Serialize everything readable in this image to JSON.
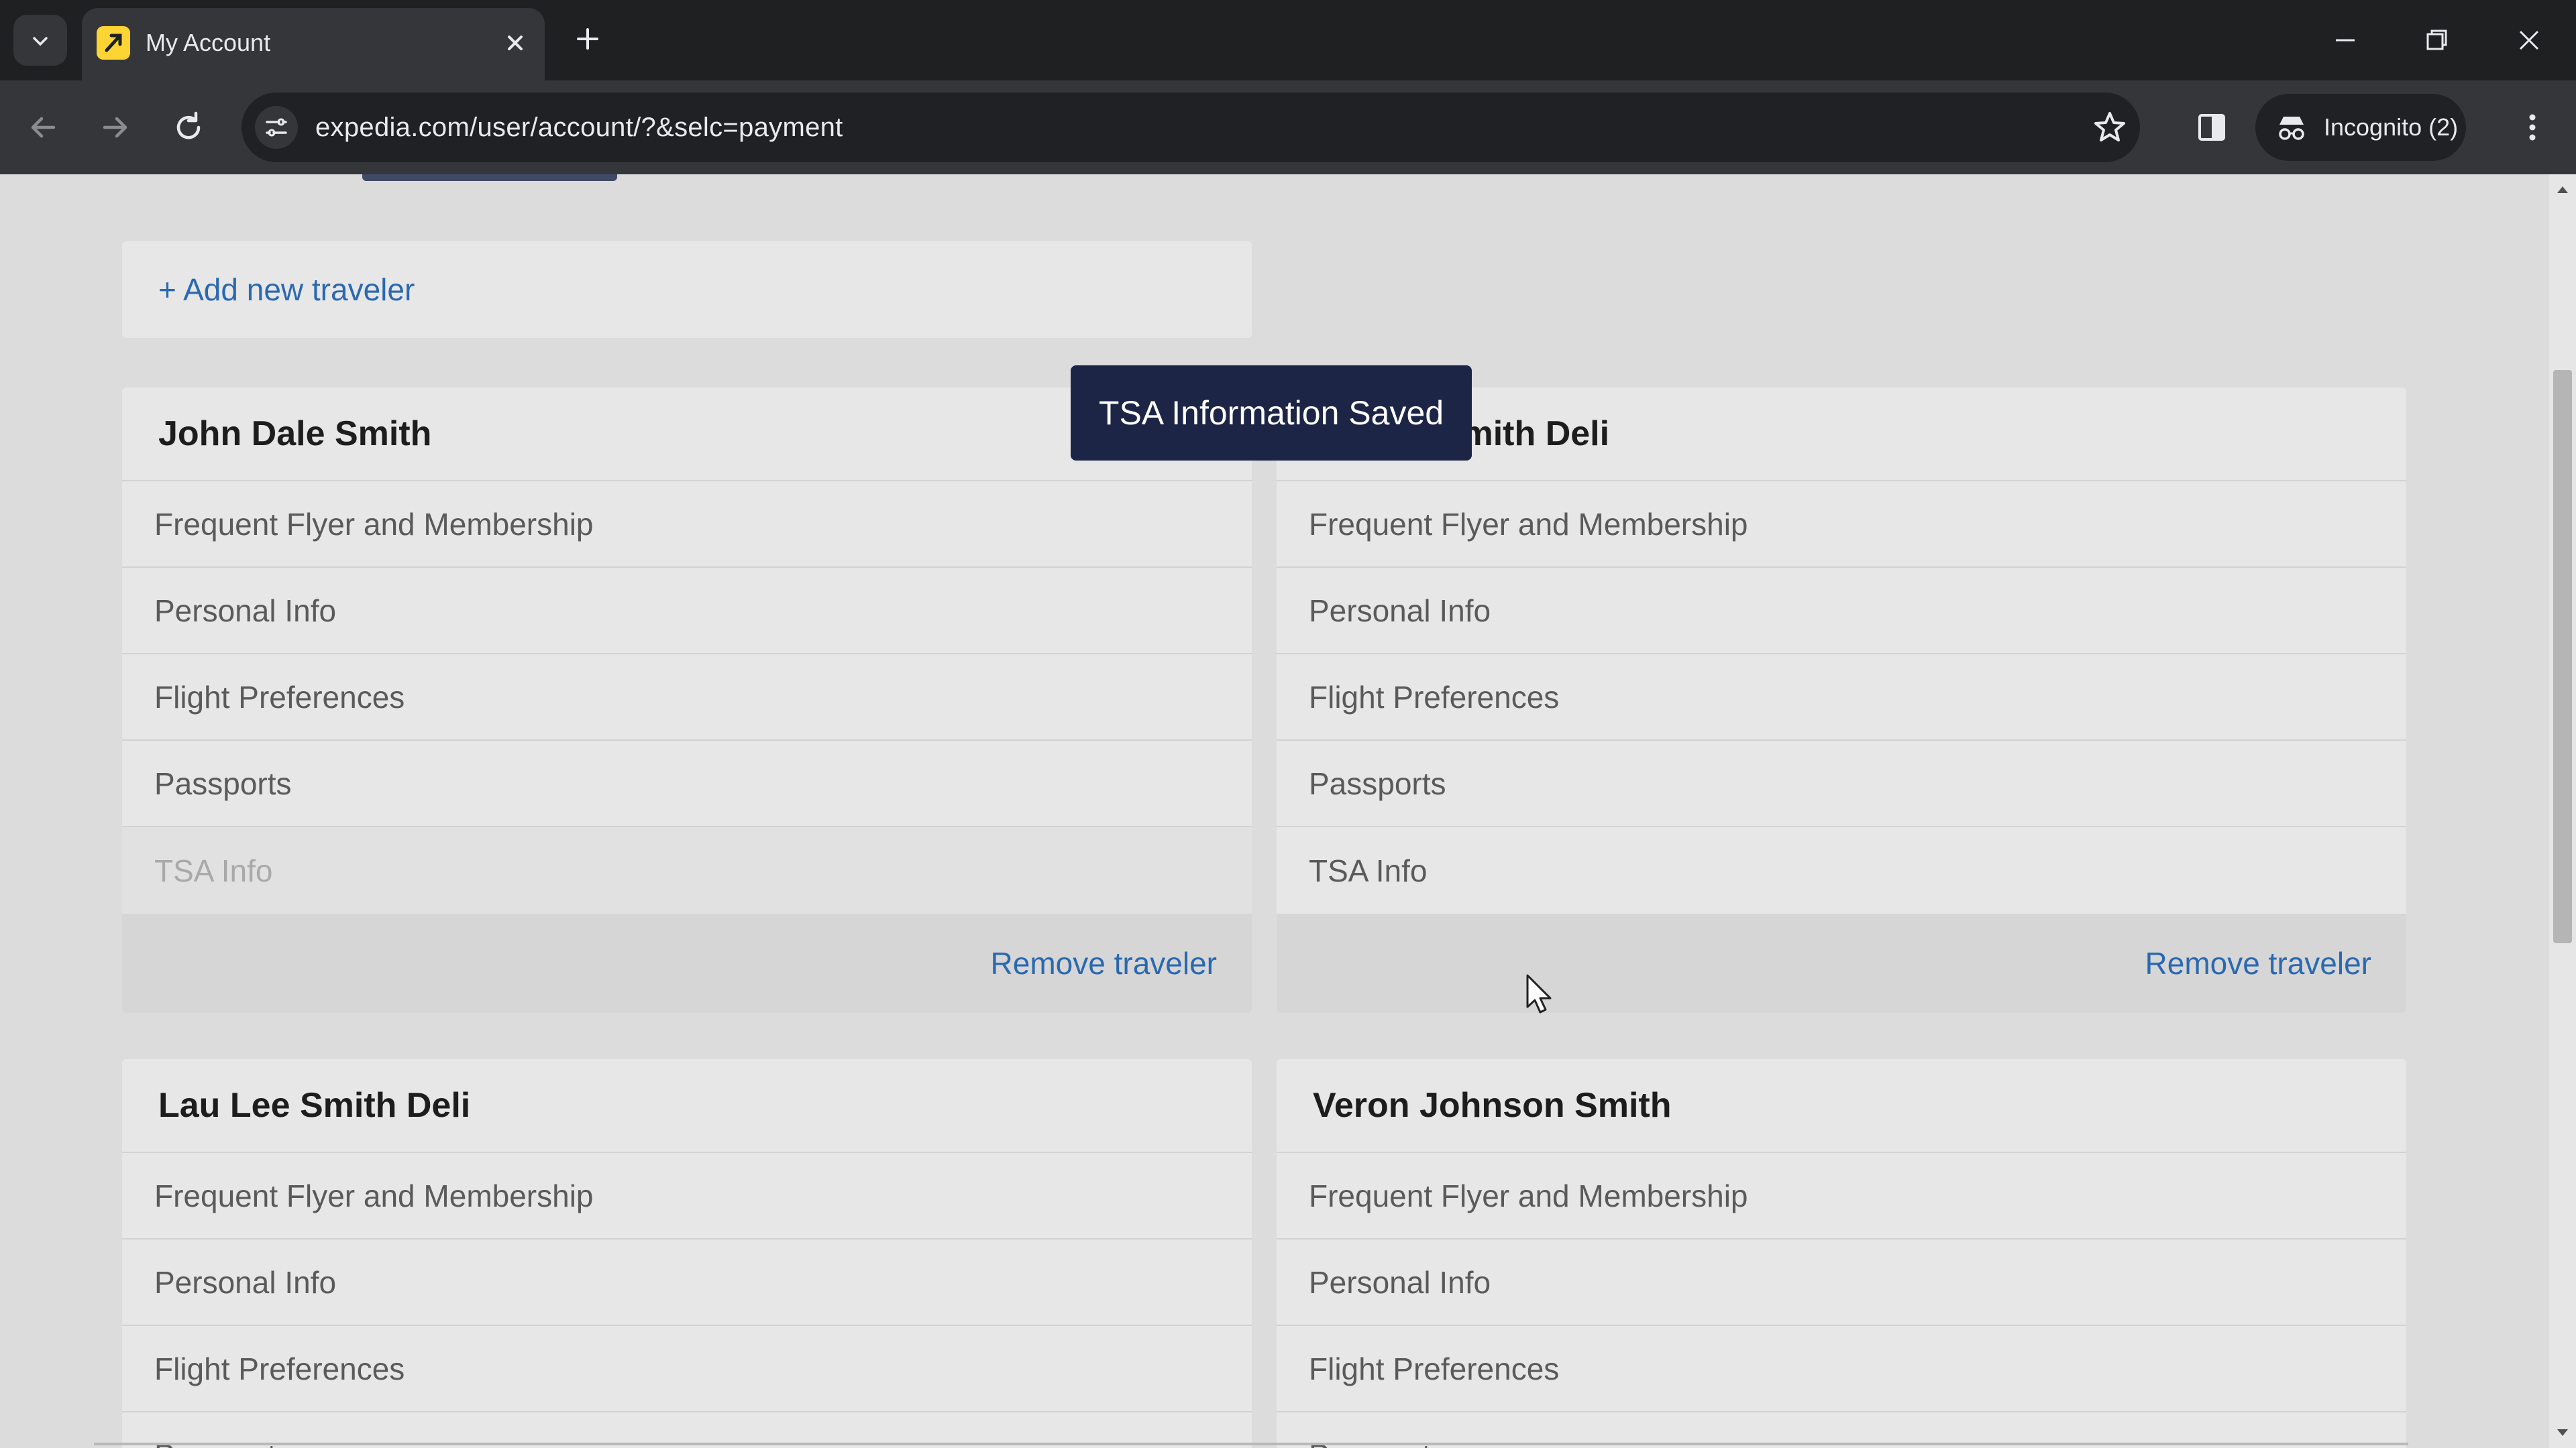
{
  "browser": {
    "tab": {
      "title": "My Account"
    },
    "url": "expedia.com/user/account/?&selc=payment",
    "incognito_label": "Incognito (2)"
  },
  "page": {
    "add_traveler_label": "+ Add new traveler",
    "toast": "TSA Information Saved",
    "travelers": [
      {
        "name": "John Dale Smith",
        "items": [
          "Frequent Flyer and Membership",
          "Personal Info",
          "Flight Preferences",
          "Passports",
          "TSA Info"
        ],
        "remove_label": "Remove traveler"
      },
      {
        "name": "Lauren Smith Deli",
        "items": [
          "Frequent Flyer and Membership",
          "Personal Info",
          "Flight Preferences",
          "Passports",
          "TSA Info"
        ],
        "remove_label": "Remove traveler"
      },
      {
        "name": "Lau Lee Smith Deli",
        "items": [
          "Frequent Flyer and Membership",
          "Personal Info",
          "Flight Preferences",
          "Passports"
        ]
      },
      {
        "name": "Veron Johnson Smith",
        "items": [
          "Frequent Flyer and Membership",
          "Personal Info",
          "Flight Preferences",
          "Passports"
        ]
      }
    ]
  },
  "colors": {
    "link": "#2a69b1",
    "toast_bg": "#1d2547",
    "favicon": "#fcd535"
  }
}
